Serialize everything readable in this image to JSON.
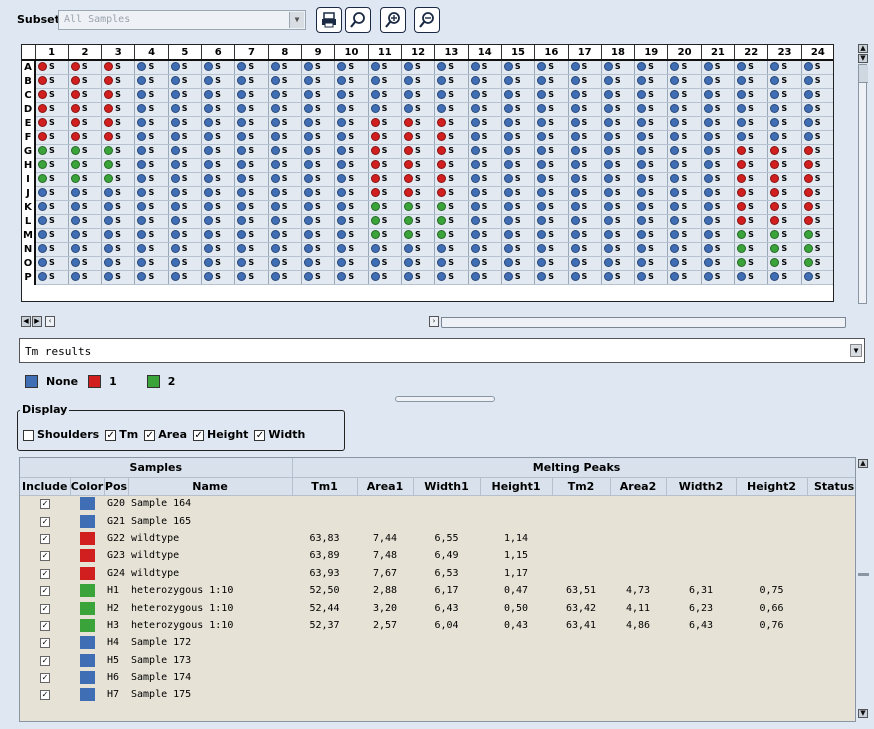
{
  "subset": {
    "label": "Subset:",
    "value": "All Samples"
  },
  "toolbar": {
    "buttons": [
      "print-icon",
      "zoom-icon",
      "select-samples-icon",
      "deselect-samples-icon"
    ]
  },
  "plate": {
    "columns": [
      "1",
      "2",
      "3",
      "4",
      "5",
      "6",
      "7",
      "8",
      "9",
      "10",
      "11",
      "12",
      "13",
      "14",
      "15",
      "16",
      "17",
      "18",
      "19",
      "20",
      "21",
      "22",
      "23",
      "24"
    ],
    "rows": [
      "A",
      "B",
      "C",
      "D",
      "E",
      "F",
      "G",
      "H",
      "I",
      "J",
      "K",
      "L",
      "M",
      "N",
      "O",
      "P"
    ],
    "well_label": "S",
    "colors": {
      "none": "#3f6eb5",
      "group1": "#d11e1e",
      "group2": "#3aa33a"
    },
    "groups": [
      "111000000000000000000000",
      "111000000000000000000000",
      "111000000000000000000000",
      "111000000000000000000000",
      "111000000011100000000000",
      "111000000011100000000000",
      "222000000011100000000111",
      "222000000011100000000111",
      "222000000011100000000111",
      "000000000011100000000111",
      "000000000022200000000111",
      "000000000022200000000111",
      "000000000022200000000222",
      "000000000000000000000222",
      "000000000000000000000222",
      "000000000000000000000000"
    ]
  },
  "result_view": {
    "value": "Tm results"
  },
  "legend": [
    {
      "label": "None",
      "color": "#3f6eb5"
    },
    {
      "label": "1",
      "color": "#d11e1e"
    },
    {
      "label": "2",
      "color": "#3aa33a"
    }
  ],
  "display": {
    "title": "Display",
    "options": [
      {
        "label": "Shoulders",
        "checked": false
      },
      {
        "label": "Tm",
        "checked": true
      },
      {
        "label": "Area",
        "checked": true
      },
      {
        "label": "Height",
        "checked": true
      },
      {
        "label": "Width",
        "checked": true
      }
    ]
  },
  "results": {
    "group_headers": {
      "samples": "Samples",
      "peaks": "Melting Peaks"
    },
    "columns": [
      "Include",
      "Color",
      "Pos",
      "Name",
      "Tm1",
      "Area1",
      "Width1",
      "Height1",
      "Tm2",
      "Area2",
      "Width2",
      "Height2",
      "Status"
    ],
    "rows": [
      {
        "include": true,
        "color": "#3f6eb5",
        "pos": "G20",
        "name": "Sample 164",
        "tm1": "",
        "area1": "",
        "width1": "",
        "height1": "",
        "tm2": "",
        "area2": "",
        "width2": "",
        "height2": ""
      },
      {
        "include": true,
        "color": "#3f6eb5",
        "pos": "G21",
        "name": "Sample 165",
        "tm1": "",
        "area1": "",
        "width1": "",
        "height1": "",
        "tm2": "",
        "area2": "",
        "width2": "",
        "height2": ""
      },
      {
        "include": true,
        "color": "#d11e1e",
        "pos": "G22",
        "name": "wildtype",
        "tm1": "63,83",
        "area1": "7,44",
        "width1": "6,55",
        "height1": "1,14",
        "tm2": "",
        "area2": "",
        "width2": "",
        "height2": ""
      },
      {
        "include": true,
        "color": "#d11e1e",
        "pos": "G23",
        "name": "wildtype",
        "tm1": "63,89",
        "area1": "7,48",
        "width1": "6,49",
        "height1": "1,15",
        "tm2": "",
        "area2": "",
        "width2": "",
        "height2": ""
      },
      {
        "include": true,
        "color": "#d11e1e",
        "pos": "G24",
        "name": "wildtype",
        "tm1": "63,93",
        "area1": "7,67",
        "width1": "6,53",
        "height1": "1,17",
        "tm2": "",
        "area2": "",
        "width2": "",
        "height2": ""
      },
      {
        "include": true,
        "color": "#3aa33a",
        "pos": "H1",
        "name": "heterozygous 1:10",
        "tm1": "52,50",
        "area1": "2,88",
        "width1": "6,17",
        "height1": "0,47",
        "tm2": "63,51",
        "area2": "4,73",
        "width2": "6,31",
        "height2": "0,75"
      },
      {
        "include": true,
        "color": "#3aa33a",
        "pos": "H2",
        "name": "heterozygous 1:10",
        "tm1": "52,44",
        "area1": "3,20",
        "width1": "6,43",
        "height1": "0,50",
        "tm2": "63,42",
        "area2": "4,11",
        "width2": "6,23",
        "height2": "0,66"
      },
      {
        "include": true,
        "color": "#3aa33a",
        "pos": "H3",
        "name": "heterozygous 1:10",
        "tm1": "52,37",
        "area1": "2,57",
        "width1": "6,04",
        "height1": "0,43",
        "tm2": "63,41",
        "area2": "4,86",
        "width2": "6,43",
        "height2": "0,76"
      },
      {
        "include": true,
        "color": "#3f6eb5",
        "pos": "H4",
        "name": "Sample 172",
        "tm1": "",
        "area1": "",
        "width1": "",
        "height1": "",
        "tm2": "",
        "area2": "",
        "width2": "",
        "height2": ""
      },
      {
        "include": true,
        "color": "#3f6eb5",
        "pos": "H5",
        "name": "Sample 173",
        "tm1": "",
        "area1": "",
        "width1": "",
        "height1": "",
        "tm2": "",
        "area2": "",
        "width2": "",
        "height2": ""
      },
      {
        "include": true,
        "color": "#3f6eb5",
        "pos": "H6",
        "name": "Sample 174",
        "tm1": "",
        "area1": "",
        "width1": "",
        "height1": "",
        "tm2": "",
        "area2": "",
        "width2": "",
        "height2": ""
      },
      {
        "include": true,
        "color": "#3f6eb5",
        "pos": "H7",
        "name": "Sample 175",
        "tm1": "",
        "area1": "",
        "width1": "",
        "height1": "",
        "tm2": "",
        "area2": "",
        "width2": "",
        "height2": ""
      }
    ]
  }
}
